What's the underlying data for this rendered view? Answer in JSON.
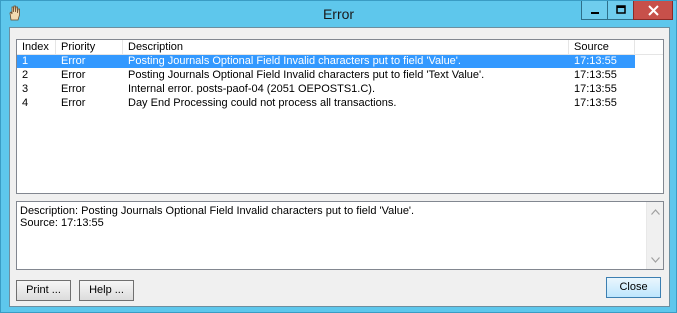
{
  "window": {
    "title": "Error",
    "icon": "hand-icon"
  },
  "list": {
    "columns": [
      "Index",
      "Priority",
      "Description",
      "Source"
    ],
    "rows": [
      {
        "index": "1",
        "priority": "Error",
        "description": "Posting Journals Optional Field  Invalid characters put to field 'Value'.",
        "source": "17:13:55",
        "selected": true
      },
      {
        "index": "2",
        "priority": "Error",
        "description": "Posting Journals Optional Field  Invalid characters put to field 'Text Value'.",
        "source": "17:13:55",
        "selected": false
      },
      {
        "index": "3",
        "priority": "Error",
        "description": "Internal error. posts-paof-04 (2051 OEPOSTS1.C).",
        "source": "17:13:55",
        "selected": false
      },
      {
        "index": "4",
        "priority": "Error",
        "description": "Day End Processing could not process all transactions.",
        "source": "17:13:55",
        "selected": false
      }
    ]
  },
  "detail": {
    "description_line": "Description: Posting Journals Optional Field  Invalid characters put to field 'Value'.",
    "source_line": "Source:  17:13:55"
  },
  "buttons": {
    "print": "Print ...",
    "help": "Help ...",
    "close": "Close"
  },
  "colors": {
    "frame": "#5ec7ec",
    "selection": "#3399ff",
    "close_control": "#c7504a"
  }
}
